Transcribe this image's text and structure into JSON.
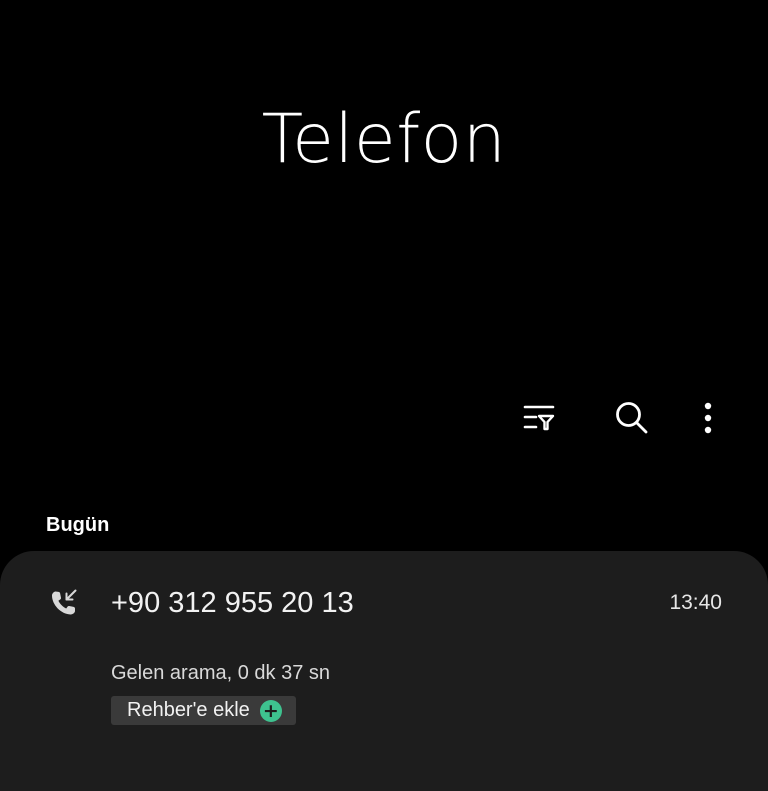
{
  "app": {
    "title": "Telefon"
  },
  "toolbar": {
    "icons": [
      "filter-icon",
      "search-icon",
      "more-options-icon"
    ]
  },
  "call_log": {
    "section_label": "Bugün",
    "entries": [
      {
        "number": "+90 312 955 20 13",
        "time": "13:40",
        "detail": "Gelen arama, 0 dk 37 sn",
        "add_contact_label": "Rehber'e ekle",
        "call_type_icon": "incoming-call-icon"
      }
    ]
  },
  "colors": {
    "background": "#000000",
    "card": "#1d1d1d",
    "accent_green": "#3ec28f"
  }
}
